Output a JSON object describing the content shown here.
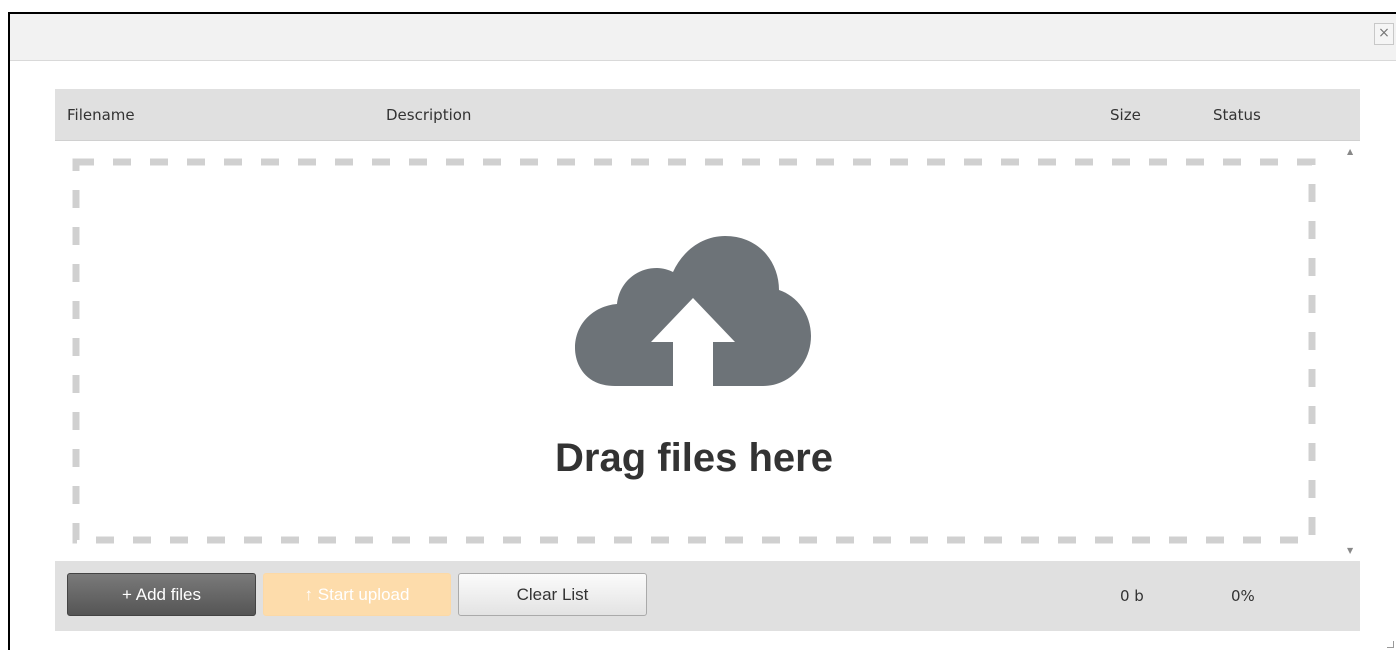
{
  "dialog": {
    "close_glyph": "×"
  },
  "header": {
    "filename": "Filename",
    "description": "Description",
    "size": "Size",
    "status": "Status"
  },
  "dropzone": {
    "text": "Drag files here",
    "icon": "cloud-upload-icon"
  },
  "footer": {
    "add_files": "+ Add files",
    "start_upload": "↑ Start upload",
    "clear_list": "Clear List",
    "total_size": "0 b",
    "total_status": "0%"
  },
  "colors": {
    "icon": "#6d7378",
    "header_bg": "#e0e0e0",
    "start_upload_bg": "#fddcab",
    "dashed_border": "#d0d0d0"
  }
}
